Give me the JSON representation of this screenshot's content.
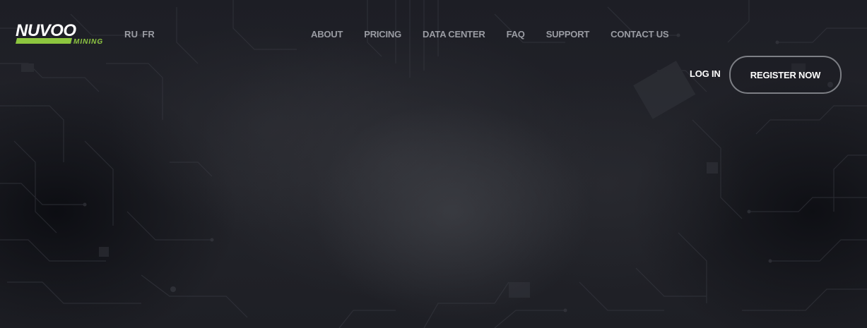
{
  "brand": {
    "name": "NUVOO",
    "tagline": "MINING",
    "accent_color": "#8dc63f"
  },
  "languages": [
    "RU",
    "FR"
  ],
  "nav": {
    "items": [
      "ABOUT",
      "PRICING",
      "DATA CENTER",
      "FAQ",
      "SUPPORT",
      "CONTACT US"
    ]
  },
  "auth": {
    "login_label": "LOG IN",
    "register_label": "REGISTER NOW"
  },
  "theme": {
    "background": "#1c1d23",
    "nav_text": "#9a9ca3",
    "auth_text": "#ffffff"
  }
}
